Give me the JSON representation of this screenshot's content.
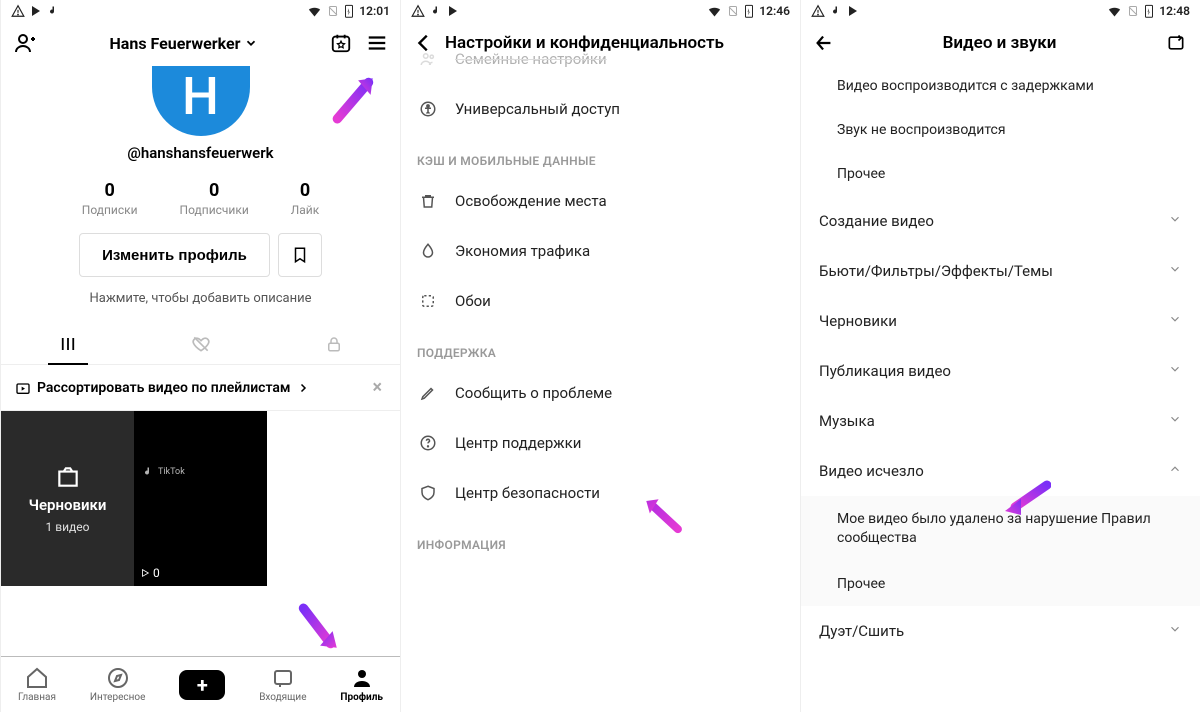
{
  "s1": {
    "status": {
      "time": "12:01"
    },
    "name": "Hans Feuerwerker",
    "handle": "@hanshansfeuerwerk",
    "avatar_letter": "H",
    "stats": [
      {
        "n": "0",
        "l": "Подписки"
      },
      {
        "n": "0",
        "l": "Подписчики"
      },
      {
        "n": "0",
        "l": "Лайк"
      }
    ],
    "edit": "Изменить профиль",
    "bio_hint": "Нажмите, чтобы добавить описание",
    "playlist": "Рассортировать видео по плейлистам",
    "drafts": {
      "label": "Черновики",
      "sub": "1 видео"
    },
    "tile_playcount": "0",
    "nav": {
      "home": "Главная",
      "discover": "Интересное",
      "inbox": "Входящие",
      "profile": "Профиль"
    }
  },
  "s2": {
    "status": {
      "time": "12:46"
    },
    "title": "Настройки и конфиденциальность",
    "rows": {
      "family_cut": "Семейные настройки",
      "accessibility": "Универсальный доступ"
    },
    "section_cache": "КЭШ И МОБИЛЬНЫЕ ДАННЫЕ",
    "rows2": {
      "free_space": "Освобождение места",
      "data_saver": "Экономия трафика",
      "wallpaper": "Обои"
    },
    "section_support": "ПОДДЕРЖКА",
    "rows3": {
      "report": "Сообщить о проблеме",
      "help": "Центр поддержки",
      "safety": "Центр безопасности"
    },
    "section_info": "ИНФОРМАЦИЯ"
  },
  "s3": {
    "status": {
      "time": "12:48"
    },
    "title": "Видео и звуки",
    "sub_top": {
      "lag": "Видео воспроизводится с задержками",
      "nosound": "Звук не воспроизводится",
      "other": "Прочее"
    },
    "items": {
      "create": "Создание видео",
      "beauty": "Бьюти/Фильтры/Эффекты/Темы",
      "drafts": "Черновики",
      "publish": "Публикация видео",
      "music": "Музыка",
      "disappeared": "Видео исчезло"
    },
    "sub_disappeared": {
      "violation": "Мое видео было удалено за нарушение Правил сообщества",
      "other": "Прочее"
    },
    "duet": "Дуэт/Сшить"
  }
}
